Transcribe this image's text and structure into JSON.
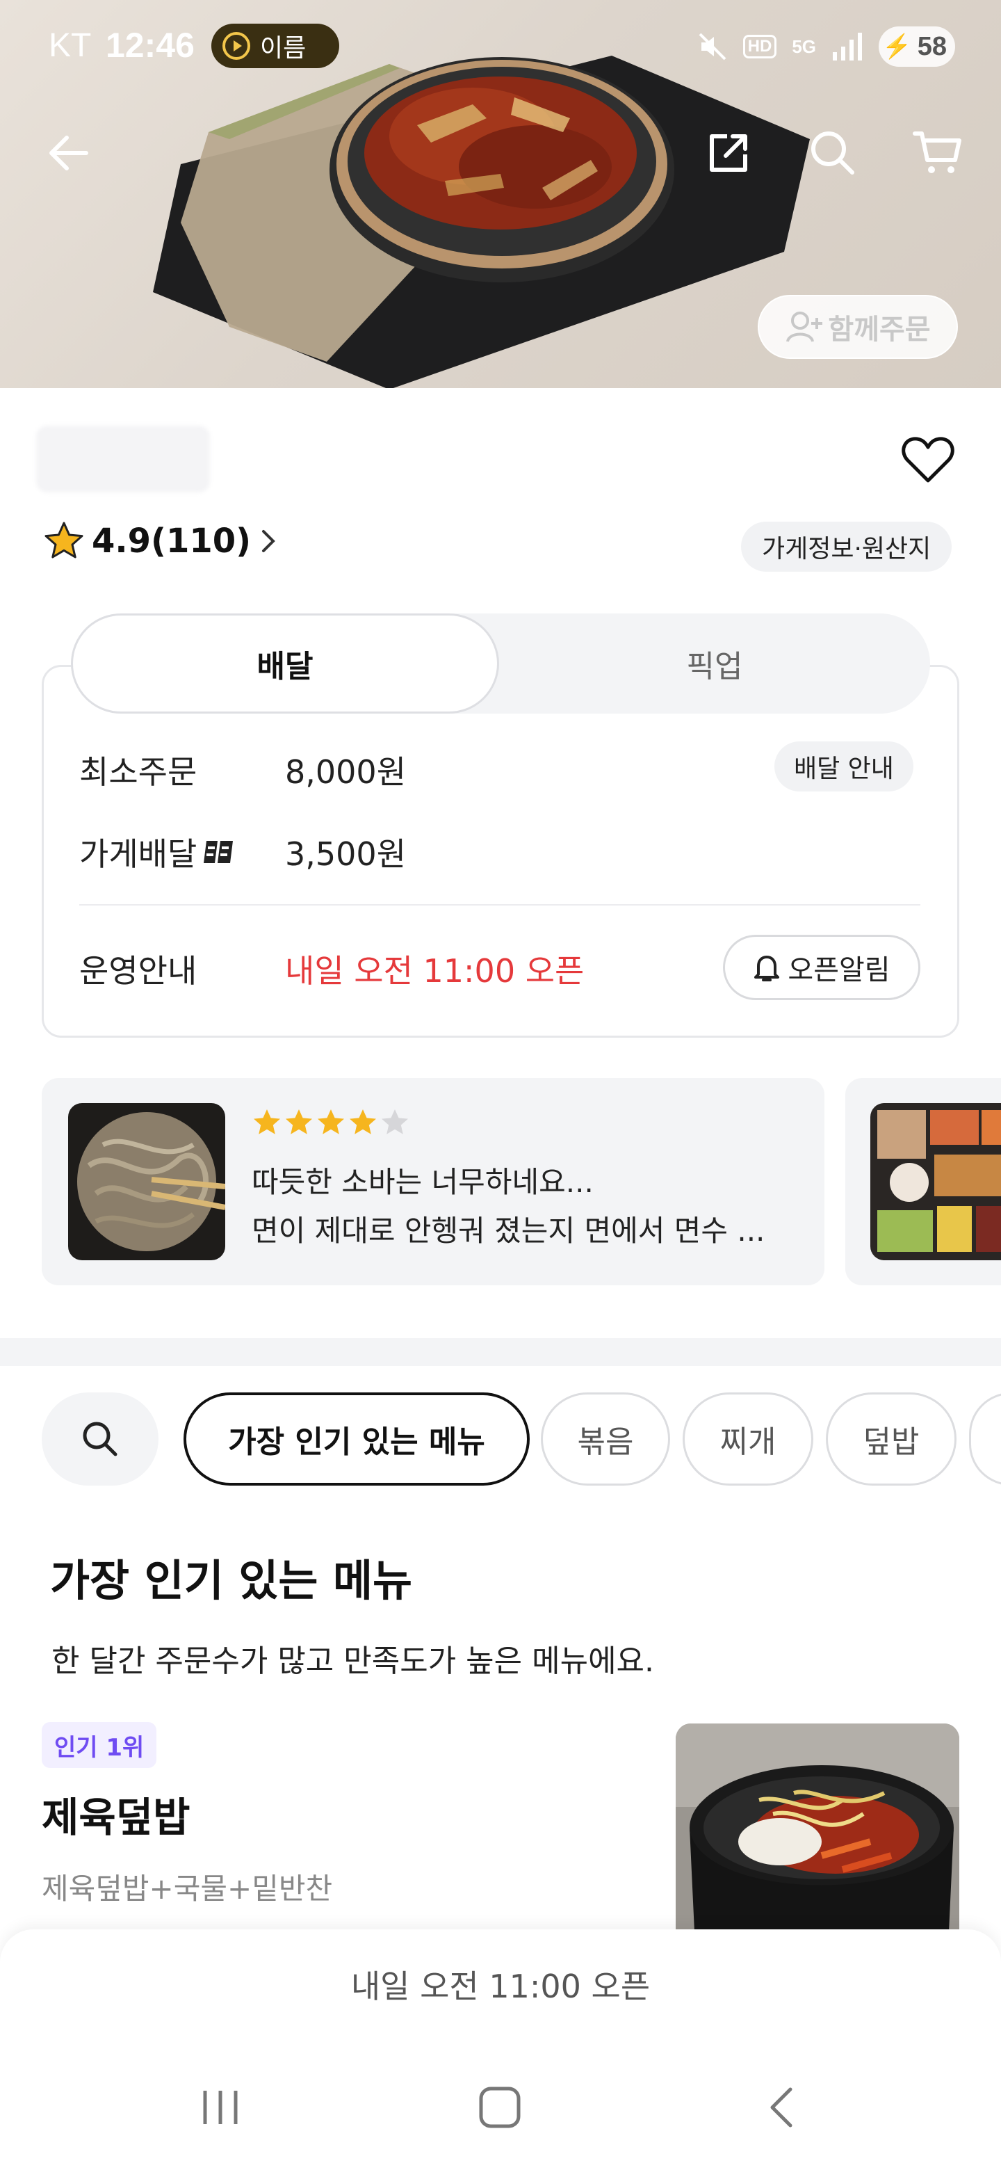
{
  "status_bar": {
    "carrier": "KT",
    "time": "12:46",
    "pill_label": "이름",
    "battery": "58",
    "network": "5G",
    "hd_label": "HD"
  },
  "hero": {
    "together_order_label": "함께주문"
  },
  "store": {
    "rating_text": "4.9(110)",
    "info_chip": "가게정보·원산지"
  },
  "order_mode": {
    "tabs": [
      "배달",
      "픽업"
    ],
    "selected": "배달"
  },
  "delivery_info": {
    "min_order_label": "최소주문",
    "min_order_value": "8,000원",
    "delivery_guide_chip": "배달 안내",
    "store_delivery_label": "가게배달",
    "store_delivery_value": "3,500원",
    "operation_label": "운영안내",
    "operation_value": "내일 오전 11:00 오픈",
    "open_alarm_label": "오픈알림"
  },
  "reviews": [
    {
      "rating": 4,
      "max_rating": 5,
      "line1": "따듯한 소바는 너무하네요...",
      "line2": "면이 제대로 안헹궈 졌는지 면에서 면수 ..."
    }
  ],
  "categories": {
    "items": [
      "가장 인기 있는 메뉴",
      "볶음",
      "찌개",
      "덮밥"
    ],
    "selected": "가장 인기 있는 메뉴"
  },
  "menu_section": {
    "title": "가장 인기 있는 메뉴",
    "subtitle": "한 달간 주문수가 많고 만족도가 높은 메뉴에요.",
    "items": [
      {
        "badge": "인기 1위",
        "name": "제육덮밥",
        "description": "제육덮밥+국물+밑반찬"
      }
    ]
  },
  "bottom_bar": {
    "status_text": "내일 오전 11:00 오픈"
  },
  "colors": {
    "accent_red": "#e5393b",
    "badge_purple": "#6f4cf2",
    "star_yellow": "#f6b51e"
  }
}
